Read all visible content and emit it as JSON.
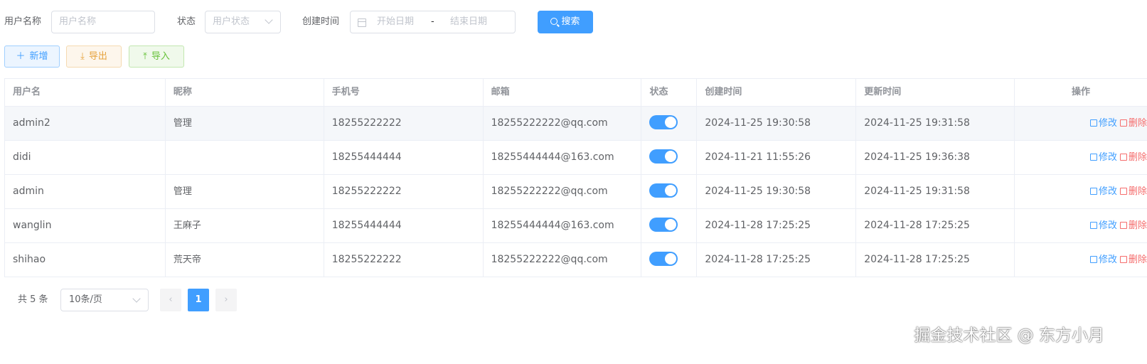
{
  "search": {
    "username_label": "用户名称",
    "username_placeholder": "用户名称",
    "status_label": "状态",
    "status_placeholder": "用户状态",
    "created_label": "创建时间",
    "start_placeholder": "开始日期",
    "range_separator": "-",
    "end_placeholder": "结束日期",
    "search_button": "搜索"
  },
  "toolbar": {
    "add": "新增",
    "export": "导出",
    "import": "导入"
  },
  "table": {
    "columns": [
      "用户名",
      "昵称",
      "手机号",
      "邮箱",
      "状态",
      "创建时间",
      "更新时间",
      "操作"
    ],
    "edit_label": "修改",
    "delete_label": "删除",
    "rows": [
      {
        "username": "admin2",
        "nickname": "管理",
        "phone": "18255222222",
        "email": "18255222222@qq.com",
        "enabled": true,
        "created": "2024-11-25 19:30:58",
        "updated": "2024-11-25 19:31:58"
      },
      {
        "username": "didi",
        "nickname": "",
        "phone": "18255444444",
        "email": "18255444444@163.com",
        "enabled": true,
        "created": "2024-11-21 11:55:26",
        "updated": "2024-11-25 19:36:38"
      },
      {
        "username": "admin",
        "nickname": "管理",
        "phone": "18255222222",
        "email": "18255222222@qq.com",
        "enabled": true,
        "created": "2024-11-25 19:30:58",
        "updated": "2024-11-25 19:31:58"
      },
      {
        "username": "wanglin",
        "nickname": "王麻子",
        "phone": "18255444444",
        "email": "18255444444@163.com",
        "enabled": true,
        "created": "2024-11-28 17:25:25",
        "updated": "2024-11-28 17:25:25"
      },
      {
        "username": "shihao",
        "nickname": "荒天帝",
        "phone": "18255222222",
        "email": "18255222222@qq.com",
        "enabled": true,
        "created": "2024-11-28 17:25:25",
        "updated": "2024-11-28 17:25:25"
      }
    ]
  },
  "pagination": {
    "total": "共 5 条",
    "page_size": "10条/页",
    "prev": "‹",
    "current_page": "1",
    "next": "›"
  },
  "watermark": "掘金技术社区 @ 东方小月",
  "colors": {
    "primary": "#409eff",
    "warning": "#e6a23c",
    "success": "#67c23a",
    "danger": "#f56c6c"
  }
}
